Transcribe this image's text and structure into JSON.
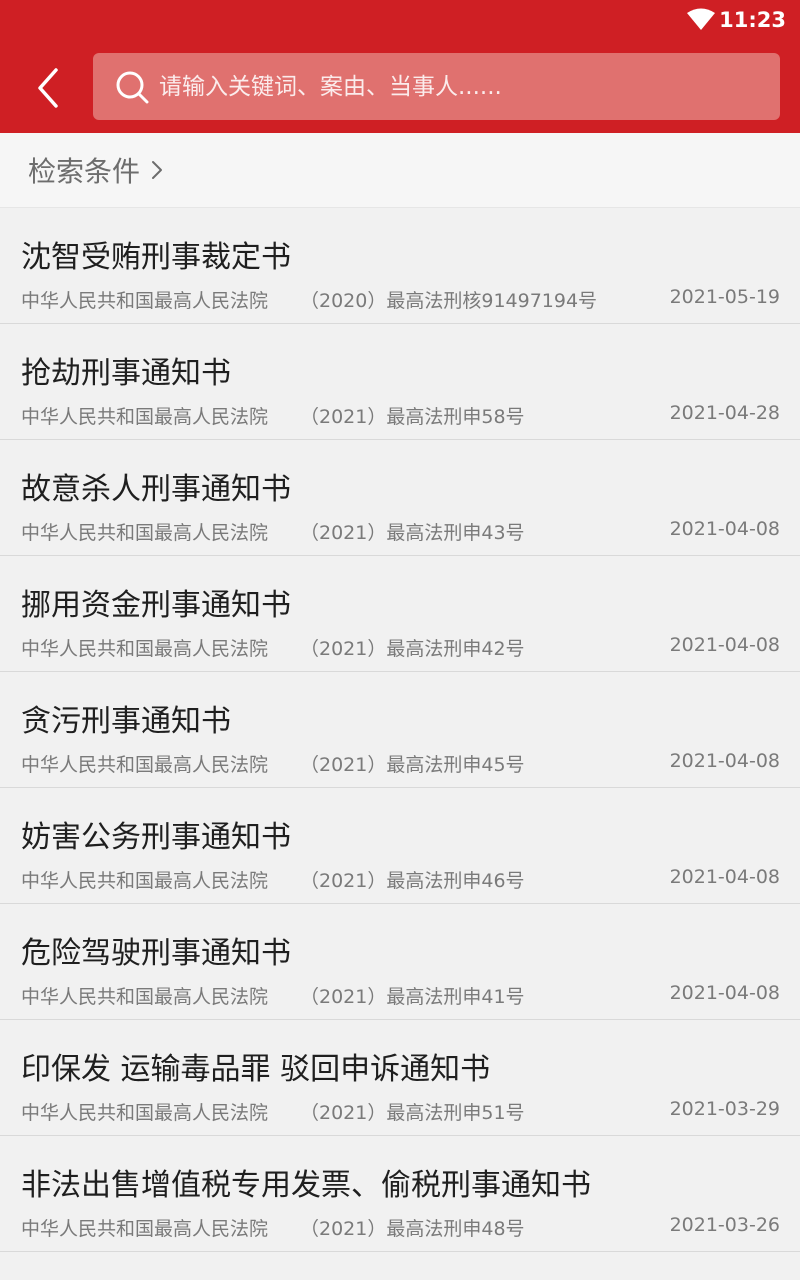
{
  "status_bar": {
    "time": "11:23"
  },
  "header": {
    "search_placeholder": "请输入关键词、案由、当事人......",
    "accent_color": "#cf1f24"
  },
  "filter": {
    "label": "检索条件"
  },
  "results": [
    {
      "title": "沈智受贿刑事裁定书",
      "court": "中华人民共和国最高人民法院",
      "case_no": "（2020）最高法刑核91497194号",
      "date": "2021-05-19"
    },
    {
      "title": "抢劫刑事通知书",
      "court": "中华人民共和国最高人民法院",
      "case_no": "（2021）最高法刑申58号",
      "date": "2021-04-28"
    },
    {
      "title": "故意杀人刑事通知书",
      "court": "中华人民共和国最高人民法院",
      "case_no": "（2021）最高法刑申43号",
      "date": "2021-04-08"
    },
    {
      "title": "挪用资金刑事通知书",
      "court": "中华人民共和国最高人民法院",
      "case_no": "（2021）最高法刑申42号",
      "date": "2021-04-08"
    },
    {
      "title": "贪污刑事通知书",
      "court": "中华人民共和国最高人民法院",
      "case_no": "（2021）最高法刑申45号",
      "date": "2021-04-08"
    },
    {
      "title": "妨害公务刑事通知书",
      "court": "中华人民共和国最高人民法院",
      "case_no": "（2021）最高法刑申46号",
      "date": "2021-04-08"
    },
    {
      "title": "危险驾驶刑事通知书",
      "court": "中华人民共和国最高人民法院",
      "case_no": "（2021）最高法刑申41号",
      "date": "2021-04-08"
    },
    {
      "title": "印保发 运输毒品罪 驳回申诉通知书",
      "court": "中华人民共和国最高人民法院",
      "case_no": "（2021）最高法刑申51号",
      "date": "2021-03-29"
    },
    {
      "title": "非法出售增值税专用发票、偷税刑事通知书",
      "court": "中华人民共和国最高人民法院",
      "case_no": "（2021）最高法刑申48号",
      "date": "2021-03-26"
    }
  ]
}
